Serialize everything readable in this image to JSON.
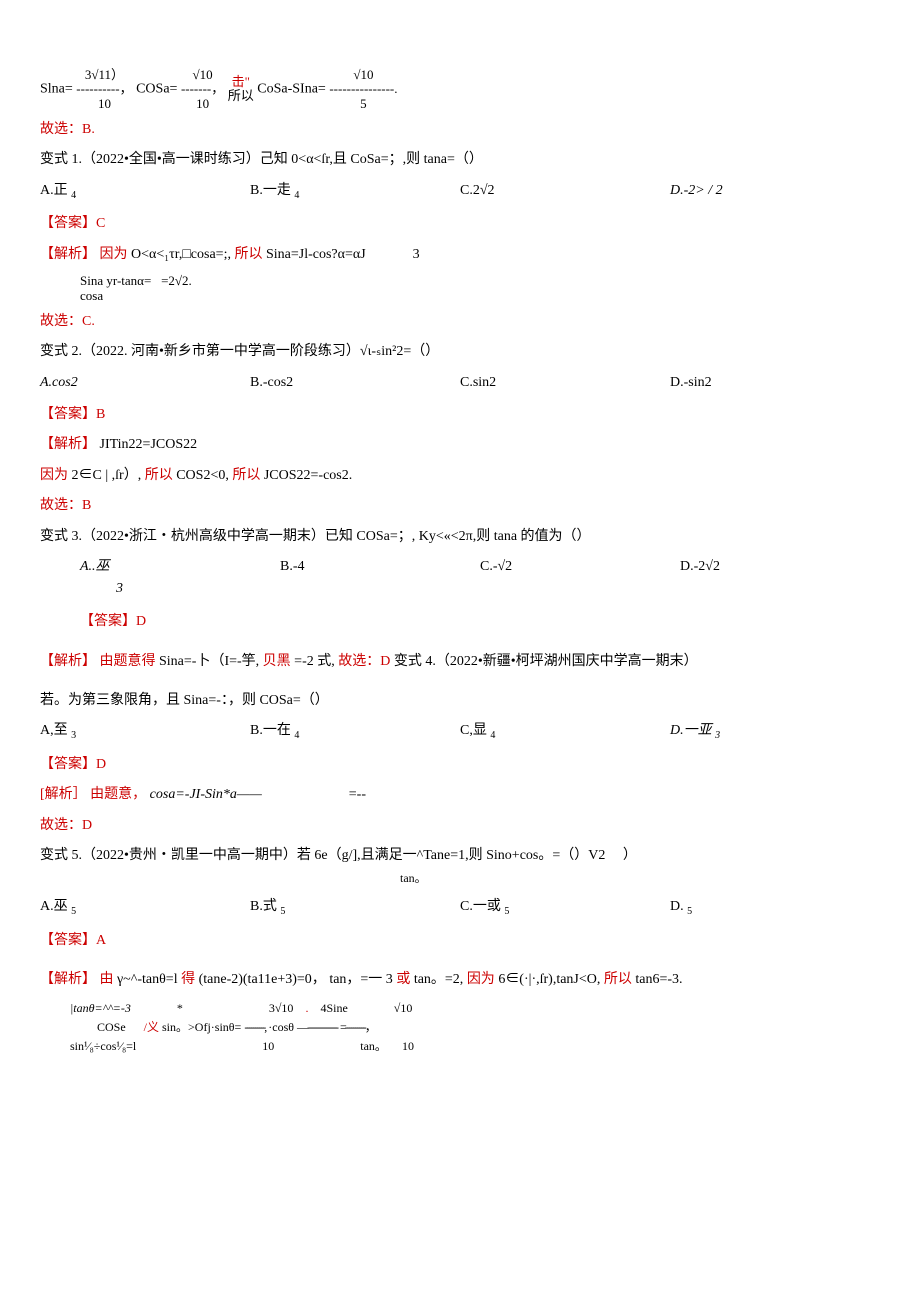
{
  "preamble": {
    "line1_a": "Slna=",
    "line1_frac1_num": "3√11）",
    "line1_frac1_den": "10",
    "line1_sep1": "----------，",
    "line1_b": "COSa=",
    "line1_frac2_num": "√10",
    "line1_frac2_den": "10",
    "line1_sep2": "-------，",
    "line1_red": "击\"",
    "line1_c": "所以",
    "line1_d": "CoSa-SIna=",
    "line1_frac3_num": "√10",
    "line1_frac3_den": "5",
    "line1_sep3": "---------------.",
    "conclude": "故选：B."
  },
  "v1": {
    "title": "变式 1.（2022•全国•高一课时练习）己知 0<α<ſr,且 CoSa=；,则 tana=（）",
    "choiceA": "A.正",
    "choiceA_sub": "4",
    "choiceB": "B.一走",
    "choiceB_sub": "4",
    "choiceC": "C.2√2",
    "choiceD": "D.-2> / 2",
    "answer_label": "【答案】",
    "answer": "C",
    "analysis_label": "【解析】",
    "analysis_red": "因为",
    "analysis_a": "O<α<₁τr,□cosa=;,",
    "analysis_red2": "所以",
    "analysis_b": "Sina=Jl-cos?α=αJ",
    "analysis_tail": "3",
    "analysis_line2a": "Sina",
    "analysis_line2b": "yr-tanα=",
    "analysis_line2c": "=2√2.",
    "analysis_line2d": "cosa",
    "conclude": "故选：C."
  },
  "v2": {
    "title": "变式 2.（2022. 河南•新乡市第一中学高一阶段练习）√ι-ₛin²2=（）",
    "choiceA": "A.cos2",
    "choiceB": "B.-cos2",
    "choiceC": "C.sin2",
    "choiceD": "D.-sin2",
    "answer_label": "【答案】",
    "answer": "B",
    "analysis_label": "【解析】",
    "analysis_a": "JITin22=JCOS22",
    "analysis_b_red": "因为",
    "analysis_b": "2∈C | ,ſr）,",
    "analysis_b_red2": "所以",
    "analysis_b2": "COS2<0,",
    "analysis_b_red3": "所以",
    "analysis_b3": "JCOS22=-cos2.",
    "conclude": "故选：B"
  },
  "v3": {
    "title": "变式 3.（2022•浙江・杭州高级中学高一期末）已知 COSa=；, Ky<«<2π,则 tana 的值为（）",
    "choiceA": "A..巫",
    "choiceA_sub": "3",
    "choiceB": "B.-4",
    "choiceC": "C.-√2",
    "choiceD": "D.-2√2",
    "answer_label": "【答案】",
    "answer": "D",
    "analysis_label": "【解析】",
    "analysis_red": "由题意得",
    "analysis_a": "Sina=-卜（I=-竽,",
    "analysis_red2": "贝黑",
    "analysis_b": "=-2 式,",
    "analysis_red3": "故选：D",
    "tail": "变式 4.（2022•新疆•柯坪湖州国庆中学高一期末）"
  },
  "v4": {
    "title": "若。为第三象限角，且 Sina=-：，则 COSa=（）",
    "choiceA": "A,至",
    "choiceA_sub": "3",
    "choiceB": "B.一在",
    "choiceB_sub": "4",
    "choiceC": "C,显",
    "choiceC_sub": "4",
    "choiceD": "D.一亚",
    "choiceD_sub": "3",
    "answer_label": "【答案】",
    "answer": "D",
    "analysis_label": "[解析］",
    "analysis_red": "由题意，",
    "analysis_a": "cosa=-JI-Sin*a——",
    "analysis_b": "=--",
    "conclude": "故选：D"
  },
  "v5": {
    "title_a": "变式 5.（2022•贵州・凯里一中高一期中）若 6e（g/],且满足一^Tane=1,则 Sino+cos。=（）V2",
    "title_b": "tan。",
    "title_tail": "）",
    "choiceA": "A.巫",
    "choiceA_sub": "5",
    "choiceB": "B.式",
    "choiceB_sub": "5",
    "choiceC": "C.一或",
    "choiceC_sub": "5",
    "choiceD": "D.",
    "choiceD_sub": "5",
    "answer_label": "【答案】",
    "answer": "A",
    "analysis_label": "【解析】",
    "analysis_red": "由",
    "analysis_a": "γ~^-tanθ=l",
    "analysis_red2": "得",
    "analysis_b": "(tane-2)(ta11e+3)=0，",
    "analysis_c": "tan，=一 3",
    "analysis_red3": "或",
    "analysis_d": "tan。=2,",
    "analysis_red4": "因为",
    "analysis_e": "6∈(·|·,ſr),tanJ<O,",
    "analysis_red5": "所以",
    "analysis_f": "tan6=-3.",
    "formula_l1": "|tanθ=^^=-3",
    "formula_star": "*",
    "formula_a": "3√10",
    "formula_b": "4Sine",
    "formula_c": "√10",
    "formula_l2a": "COSe",
    "formula_l2b_red": "/义",
    "formula_l2c": "sin。>Ofj·sinθ=",
    "formula_l2d": "----------,",
    "formula_l2e": "·cosθ",
    "formula_l2f": "—---------------",
    "formula_l2g": "=----------，",
    "formula_l3a": "sin¹⁄₈÷cos¹⁄₈=l",
    "formula_l3b": "10",
    "formula_l3c": "tan。",
    "formula_l3d": "10"
  }
}
